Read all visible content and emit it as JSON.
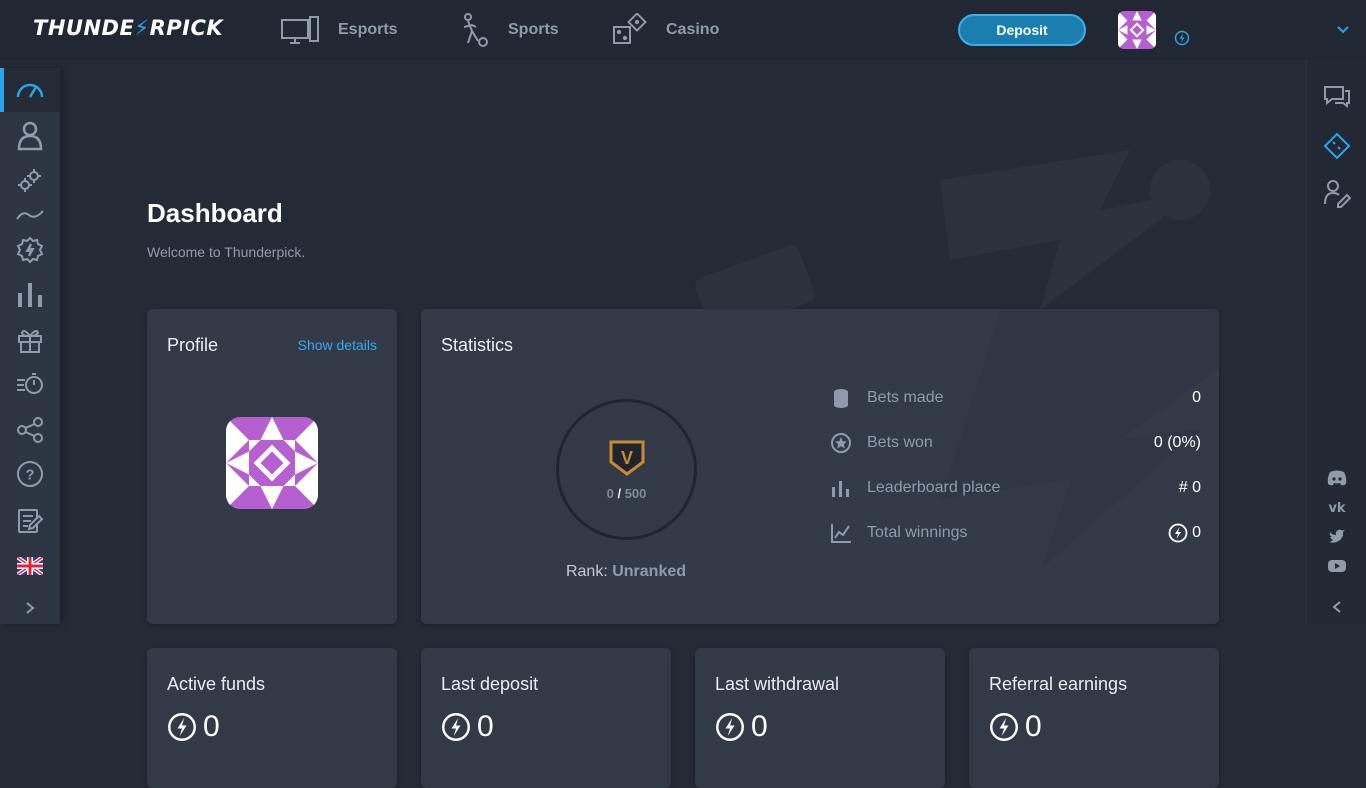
{
  "brand": {
    "name_part1": "THUNDE",
    "name_part2": "RPICK"
  },
  "nav": [
    {
      "label": "Esports",
      "icon": "monitor-icon"
    },
    {
      "label": "Sports",
      "icon": "soccer-player-icon"
    },
    {
      "label": "Casino",
      "icon": "dice-icon"
    }
  ],
  "header": {
    "deposit_label": "Deposit"
  },
  "page": {
    "title": "Dashboard",
    "subtitle": "Welcome to Thunderpick."
  },
  "profile": {
    "title": "Profile",
    "show_details": "Show details"
  },
  "statistics": {
    "title": "Statistics",
    "rank_progress_current": "0",
    "rank_progress_sep": "/",
    "rank_progress_max": "500",
    "rank_badge_letter": "V",
    "rank_label": "Rank:",
    "rank_value": "Unranked",
    "rows": [
      {
        "label": "Bets made",
        "value": "0",
        "icon": "coins-icon"
      },
      {
        "label": "Bets won",
        "value": "0 (0%)",
        "icon": "star-circle-icon"
      },
      {
        "label": "Leaderboard place",
        "value": "# 0",
        "icon": "bar-chart-icon"
      },
      {
        "label": "Total winnings",
        "value": "0",
        "icon": "trend-chart-icon"
      }
    ]
  },
  "funds": [
    {
      "title": "Active funds",
      "value": "0"
    },
    {
      "title": "Last deposit",
      "value": "0"
    },
    {
      "title": "Last withdrawal",
      "value": "0"
    },
    {
      "title": "Referral earnings",
      "value": "0"
    }
  ],
  "colors": {
    "accent": "#2aa4e8",
    "background": "#252b36",
    "card": "#333a47",
    "avatar_purple": "#b55fd0"
  }
}
